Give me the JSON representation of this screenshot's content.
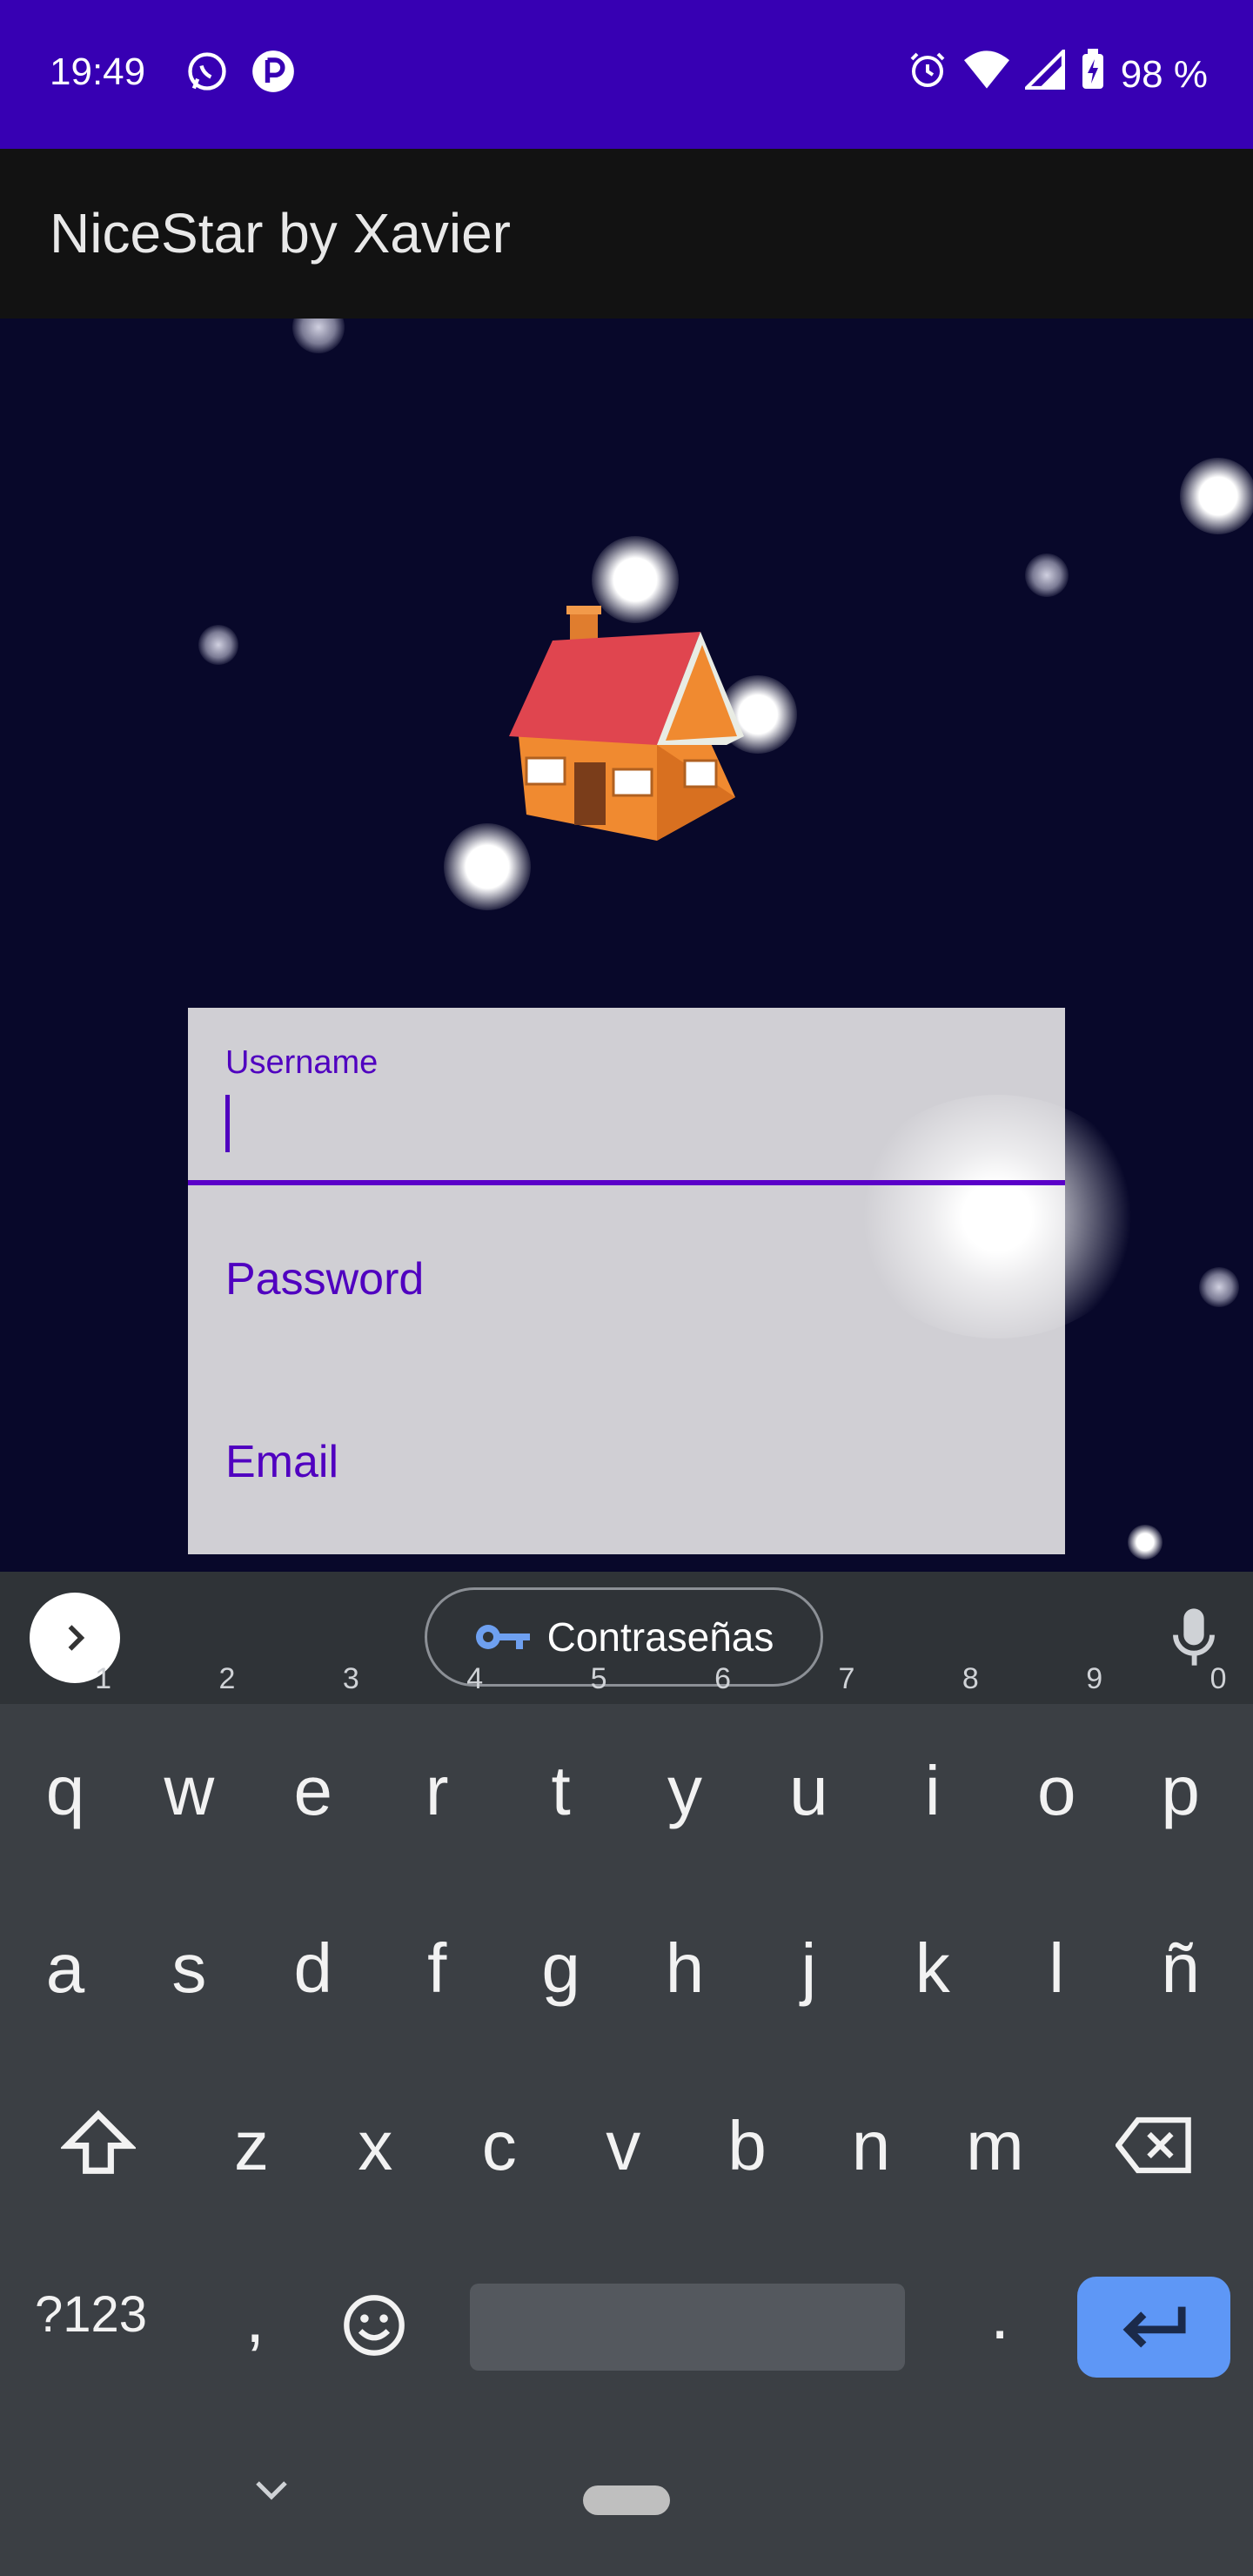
{
  "status_bar": {
    "time": "19:49",
    "battery": "98 %",
    "icons": [
      "whatsapp-icon",
      "app-notification-icon",
      "alarm-icon",
      "wifi-icon",
      "signal-icon",
      "battery-charging-icon"
    ]
  },
  "app_bar": {
    "title": "NiceStar by Xavier"
  },
  "form": {
    "username_label": "Username",
    "password_label": "Password",
    "email_label": "Email"
  },
  "keyboard": {
    "suggestion_chip": "Contraseñas",
    "row1": [
      {
        "k": "q",
        "n": "1"
      },
      {
        "k": "w",
        "n": "2"
      },
      {
        "k": "e",
        "n": "3"
      },
      {
        "k": "r",
        "n": "4"
      },
      {
        "k": "t",
        "n": "5"
      },
      {
        "k": "y",
        "n": "6"
      },
      {
        "k": "u",
        "n": "7"
      },
      {
        "k": "i",
        "n": "8"
      },
      {
        "k": "o",
        "n": "9"
      },
      {
        "k": "p",
        "n": "0"
      }
    ],
    "row2": [
      "a",
      "s",
      "d",
      "f",
      "g",
      "h",
      "j",
      "k",
      "l",
      "ñ"
    ],
    "row3": [
      "z",
      "x",
      "c",
      "v",
      "b",
      "n",
      "m"
    ],
    "symbols_key": "?123",
    "comma_key": ",",
    "period_key": "."
  },
  "colors": {
    "status_bar": "#3700b3",
    "accent": "#5000c0",
    "enter_key": "#5e97f6"
  }
}
